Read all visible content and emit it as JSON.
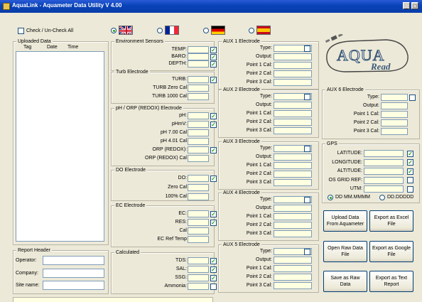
{
  "window": {
    "title": "AquaLink - Aquameter Data Utility V 4.00",
    "minimize": "_",
    "maximize": "□"
  },
  "check_all": {
    "label": "Check / Un-Check All",
    "checked": false
  },
  "uploaded": {
    "title": "Uploaded Data",
    "columns": [
      "Tag",
      "Date",
      "Time"
    ]
  },
  "report": {
    "title": "Report Header",
    "operator": "Operator:",
    "company": "Company:",
    "site": "Site name:"
  },
  "languages": [
    {
      "name": "uk-flag-icon",
      "selected": true
    },
    {
      "name": "france-flag-icon",
      "selected": false
    },
    {
      "name": "germany-flag-icon",
      "selected": false
    },
    {
      "name": "spain-flag-icon",
      "selected": false
    }
  ],
  "env": {
    "title": "Environment Sensors",
    "labels": [
      "TEMP:",
      "BARO:",
      "DEPTH:"
    ],
    "checks": [
      true,
      true,
      true
    ]
  },
  "turb": {
    "title": "Turb Electrode",
    "labels": [
      "TURB:",
      "TURB Zero Cal",
      "TURB 1000 Cal"
    ],
    "checks": [
      true
    ]
  },
  "ph": {
    "title": "pH / ORP (REDOX) Electrode",
    "labels": [
      "pH:",
      "pHmV:",
      "pH 7.00 Cal",
      "pH 4.01 Cal",
      "ORP (REDOX):",
      "ORP (REDOX) Cal"
    ],
    "checks": [
      true,
      true,
      null,
      null,
      true,
      null
    ]
  },
  "do": {
    "title": "DO Electrode",
    "labels": [
      "DO:",
      "Zero Cal",
      "100% Cal"
    ],
    "checks": [
      true
    ]
  },
  "ec": {
    "title": "EC Electrode",
    "labels": [
      "EC:",
      "RES:",
      "Cal",
      "EC Ref Temp"
    ],
    "checks": [
      true,
      true
    ]
  },
  "calc": {
    "title": "Calculated",
    "labels": [
      "TDS:",
      "SAL:",
      "SSG:",
      "Ammonia:"
    ],
    "checks": [
      true,
      true,
      true,
      false
    ]
  },
  "aux": [
    {
      "title": "AUX 1 Electrode",
      "labels": [
        "Type:",
        "Output:",
        "Point 1 Cal:",
        "Point 2 Cal:",
        "Point 3 Cal:"
      ],
      "type_checked": false
    },
    {
      "title": "AUX 2 Electrode",
      "labels": [
        "Type:",
        "Output:",
        "Point 1 Cal:",
        "Point 2 Cal:",
        "Point 3 Cal:"
      ],
      "type_checked": false
    },
    {
      "title": "AUX 3 Electrode",
      "labels": [
        "Type:",
        "Output:",
        "Point 1 Cal:",
        "Point 2 Cal:",
        "Point 3 Cal:"
      ],
      "type_checked": false
    },
    {
      "title": "AUX 4 Electrode",
      "labels": [
        "Type:",
        "Output:",
        "Point 1 Cal:",
        "Point 2 Cal:",
        "Point 3 Cal:"
      ],
      "type_checked": false
    },
    {
      "title": "AUX 5 Electrode",
      "labels": [
        "Type:",
        "Output:",
        "Point 1 Cal:",
        "Point 2 Cal:",
        "Point 3 Cal:"
      ],
      "type_checked": false
    }
  ],
  "aux6": {
    "title": "AUX 6 Electrode",
    "labels": [
      "Type:",
      "Output:",
      "Point 1 Cal:",
      "Point 2 Cal:",
      "Point 3 Cal:"
    ],
    "type_checked": false
  },
  "logo": {
    "line1": "AQUA",
    "line2": "Read"
  },
  "gps": {
    "title": "GPS",
    "labels": [
      "LATITUDE:",
      "LONGITUDE:",
      "ALTITUDE:",
      "OS GRID REF:",
      "UTM:"
    ],
    "checks": [
      true,
      true,
      true,
      false,
      false
    ],
    "format_options": [
      "DD MM.MMMM",
      "DD.DDDDD"
    ],
    "format_selected": 0
  },
  "buttons": {
    "upload": "Upload Data From Aquameter",
    "excel": "Export as Excel File",
    "open_raw": "Open Raw Data File",
    "google": "Export as Google File",
    "save_raw": "Save as Raw Data",
    "text": "Export as Text Report"
  },
  "colors": {
    "titlebar": "#0a46b8",
    "field": "#ffffe1",
    "face": "#ece9d8",
    "check": "#21a121"
  }
}
